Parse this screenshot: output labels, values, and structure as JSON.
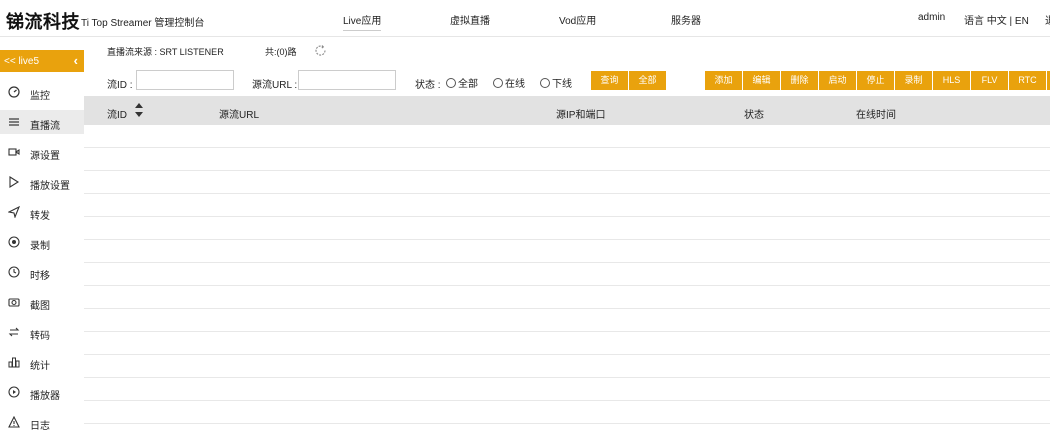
{
  "header": {
    "brand": "锑流科技",
    "subtitle": "Ti Top Streamer 管理控制台",
    "nav": [
      "Live应用",
      "虚拟直播",
      "Vod应用",
      "服务器"
    ],
    "user": "admin",
    "language": "语言 中文 | EN",
    "edge_text": "退"
  },
  "sidebar": {
    "title": "<< live5",
    "collapse_glyph": "‹",
    "items": [
      {
        "label": "监控",
        "icon": "speedometer-icon"
      },
      {
        "label": "直播流",
        "icon": "list-icon"
      },
      {
        "label": "源设置",
        "icon": "video-camera-icon"
      },
      {
        "label": "播放设置",
        "icon": "play-icon"
      },
      {
        "label": "转发",
        "icon": "send-icon"
      },
      {
        "label": "录制",
        "icon": "record-icon"
      },
      {
        "label": "时移",
        "icon": "history-icon"
      },
      {
        "label": "截图",
        "icon": "camera-icon"
      },
      {
        "label": "转码",
        "icon": "swap-icon"
      },
      {
        "label": "统计",
        "icon": "bar-chart-icon"
      },
      {
        "label": "播放器",
        "icon": "play-circle-icon"
      },
      {
        "label": "日志",
        "icon": "warning-icon"
      }
    ]
  },
  "toolbar": {
    "source": "直播流来源 : SRT LISTENER",
    "total": "共:(0)路",
    "stream_id_label": "流ID :",
    "stream_id_value": "",
    "url_label": "源流URL :",
    "url_value": "",
    "status_label": "状态 :",
    "radios": [
      "全部",
      "在线",
      "下线"
    ],
    "query": "查询",
    "all": "全部",
    "actions": [
      "添加",
      "编辑",
      "删除",
      "启动",
      "停止",
      "录制",
      "HLS",
      "FLV",
      "RTC"
    ]
  },
  "table": {
    "columns": [
      "流ID",
      "源流URL",
      "源IP和端口",
      "状态",
      "在线时间"
    ],
    "rows": []
  },
  "colors": {
    "accent": "#e9a20d",
    "header_bg": "#e2e2e2",
    "active_bg": "#ebebeb"
  }
}
